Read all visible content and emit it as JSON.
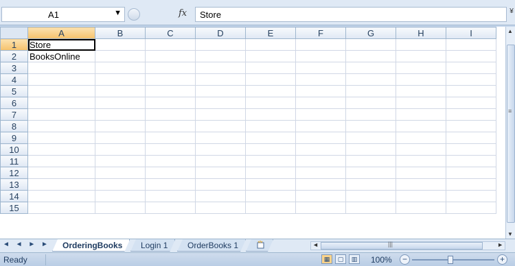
{
  "formula_bar": {
    "name_box": "A1",
    "fx_label": "fx",
    "formula_value": "Store",
    "dropdown_glyph": "▼",
    "expand_glyph": "¥"
  },
  "grid": {
    "columns": [
      "A",
      "B",
      "C",
      "D",
      "E",
      "F",
      "G",
      "H",
      "I"
    ],
    "rows": [
      "1",
      "2",
      "3",
      "4",
      "5",
      "6",
      "7",
      "8",
      "9",
      "10",
      "11",
      "12",
      "13",
      "14",
      "15"
    ],
    "cells": {
      "A1": "Store",
      "A2": "BooksOnline"
    },
    "active_cell": "A1"
  },
  "sheet_tabs": {
    "nav": "◄ ◄ ► ►",
    "tabs": [
      {
        "label": "OrderingBooks",
        "active": true
      },
      {
        "label": "Login 1",
        "active": false
      },
      {
        "label": "OrderBooks 1",
        "active": false
      }
    ],
    "insert_icon": "new-sheet-icon"
  },
  "status_bar": {
    "status": "Ready",
    "zoom": "100%",
    "zoom_out": "−",
    "zoom_in": "+"
  },
  "colors": {
    "chrome": "#c5d6ec",
    "header_selected": "#f6c26b",
    "gridline": "#d0d7e5"
  }
}
